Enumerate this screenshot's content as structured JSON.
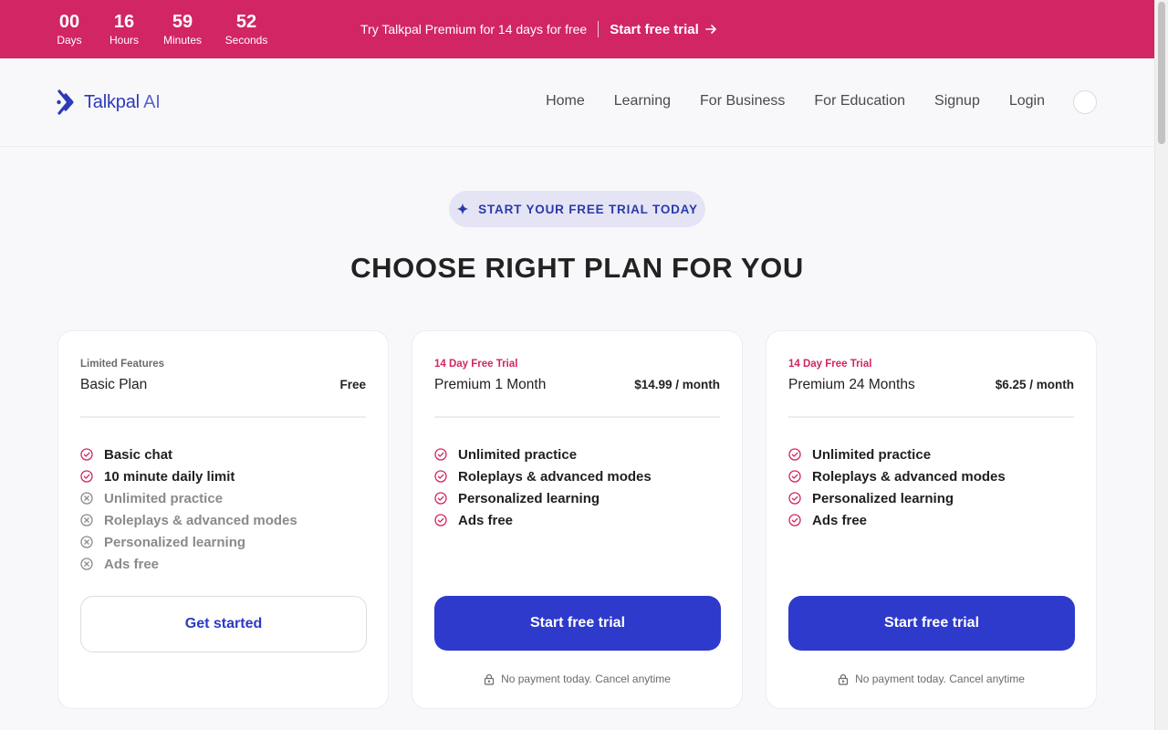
{
  "promo": {
    "countdown": [
      {
        "value": "00",
        "label": "Days"
      },
      {
        "value": "16",
        "label": "Hours"
      },
      {
        "value": "59",
        "label": "Minutes"
      },
      {
        "value": "52",
        "label": "Seconds"
      }
    ],
    "message": "Try Talkpal Premium for 14 days for free",
    "cta_label": "Start free trial",
    "bg_color": "#d12564"
  },
  "nav": {
    "logo_brand": "Talkpal",
    "logo_suffix": " AI",
    "links": [
      "Home",
      "Learning",
      "For Business",
      "For Education",
      "Signup",
      "Login"
    ]
  },
  "hero": {
    "badge": "START YOUR FREE TRIAL TODAY",
    "headline": "CHOOSE RIGHT PLAN FOR YOU"
  },
  "plans": [
    {
      "eyebrow": "Limited Features",
      "name": "Basic Plan",
      "price": "Free",
      "features": [
        {
          "label": "Basic chat",
          "included": true
        },
        {
          "label": "10 minute daily limit",
          "included": true
        },
        {
          "label": "Unlimited practice",
          "included": false
        },
        {
          "label": "Roleplays & advanced modes",
          "included": false
        },
        {
          "label": "Personalized learning",
          "included": false
        },
        {
          "label": "Ads free",
          "included": false
        }
      ],
      "button": "Get started"
    },
    {
      "eyebrow": "14 Day Free Trial",
      "name": "Premium 1 Month",
      "price": "$14.99 / month",
      "features": [
        {
          "label": "Unlimited practice",
          "included": true
        },
        {
          "label": "Roleplays & advanced modes",
          "included": true
        },
        {
          "label": "Personalized learning",
          "included": true
        },
        {
          "label": "Ads free",
          "included": true
        }
      ],
      "button": "Start free trial",
      "note": "No payment today. Cancel anytime"
    },
    {
      "eyebrow": "14 Day Free Trial",
      "name": "Premium 24 Months",
      "price": "$6.25 / month",
      "features": [
        {
          "label": "Unlimited practice",
          "included": true
        },
        {
          "label": "Roleplays & advanced modes",
          "included": true
        },
        {
          "label": "Personalized learning",
          "included": true
        },
        {
          "label": "Ads free",
          "included": true
        }
      ],
      "button": "Start free trial",
      "note": "No payment today. Cancel anytime"
    }
  ],
  "colors": {
    "accent": "#2d3acb",
    "pink": "#d12564",
    "check": "#d12564",
    "cross": "#8a8a8a"
  }
}
